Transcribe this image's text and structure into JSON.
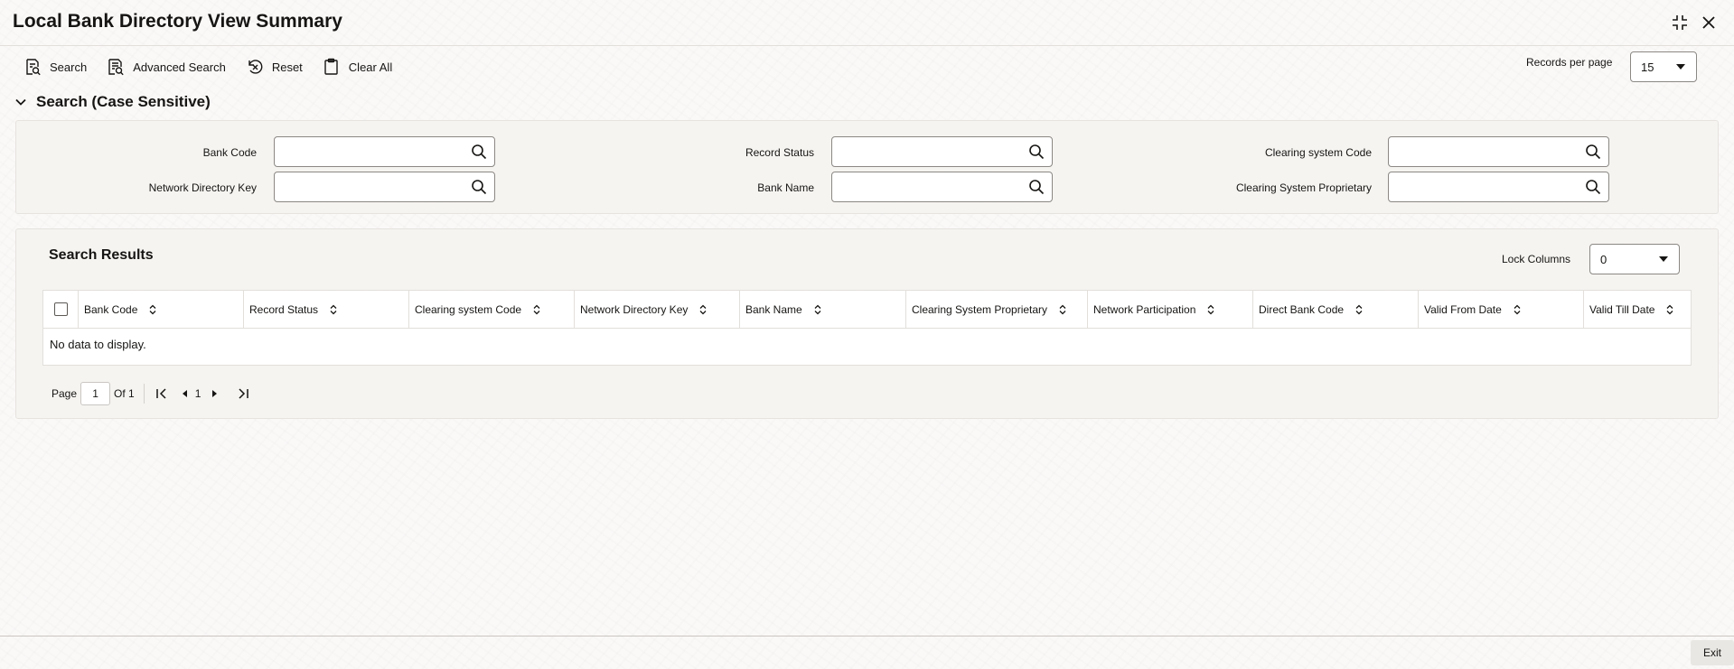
{
  "window": {
    "title": "Local Bank Directory View Summary"
  },
  "toolbar": {
    "search_label": "Search",
    "advanced_search_label": "Advanced Search",
    "reset_label": "Reset",
    "clear_all_label": "Clear All"
  },
  "records_per_page": {
    "label": "Records per page",
    "value": "15"
  },
  "search_section": {
    "title": "Search (Case Sensitive)",
    "fields": {
      "bank_code": {
        "label": "Bank Code",
        "value": ""
      },
      "network_directory_key": {
        "label": "Network Directory Key",
        "value": ""
      },
      "record_status": {
        "label": "Record Status",
        "value": ""
      },
      "bank_name": {
        "label": "Bank Name",
        "value": ""
      },
      "clearing_system_code": {
        "label": "Clearing system Code",
        "value": ""
      },
      "clearing_system_proprietary": {
        "label": "Clearing System Proprietary",
        "value": ""
      }
    }
  },
  "results": {
    "title": "Search Results",
    "lock_columns": {
      "label": "Lock Columns",
      "value": "0"
    },
    "columns": [
      "Bank Code",
      "Record Status",
      "Clearing system Code",
      "Network Directory Key",
      "Bank Name",
      "Clearing System Proprietary",
      "Network Participation",
      "Direct Bank Code",
      "Valid From Date",
      "Valid Till Date"
    ],
    "rows": [],
    "empty_message": "No data to display."
  },
  "pagination": {
    "page_label": "Page",
    "current_page": "1",
    "of_label": "Of 1",
    "page_number": "1"
  },
  "footer": {
    "exit_label": "Exit"
  }
}
